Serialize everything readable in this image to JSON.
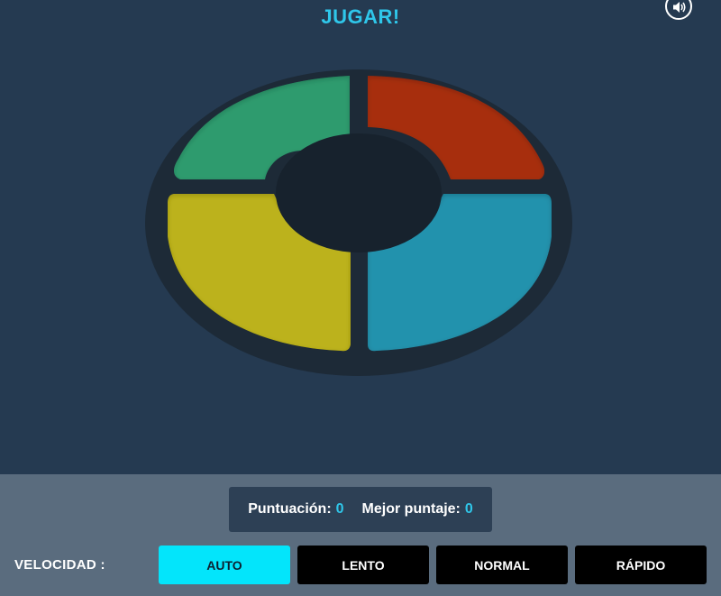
{
  "header": {
    "title": "JUGAR!"
  },
  "icons": {
    "sound": "speaker-volume-icon"
  },
  "board": {
    "pads": [
      {
        "id": "green",
        "color": "#2e9b6e"
      },
      {
        "id": "red",
        "color": "#a72f0e"
      },
      {
        "id": "yellow",
        "color": "#bcb21a"
      },
      {
        "id": "blue",
        "color": "#2292ad"
      }
    ],
    "ring_color": "#1d2a37",
    "center_color": "#17222d"
  },
  "score": {
    "score_label": "Puntuación:",
    "score_value": "0",
    "best_label": "Mejor puntaje:",
    "best_value": "0"
  },
  "speed": {
    "label": "VELOCIDAD :",
    "options": [
      "AUTO",
      "LENTO",
      "NORMAL",
      "RÁPIDO"
    ],
    "selected": "AUTO"
  },
  "colors": {
    "accent": "#2fc7ea",
    "active_button": "#03e5fb",
    "background": "#253a51",
    "panel": "#5a6c7e"
  }
}
